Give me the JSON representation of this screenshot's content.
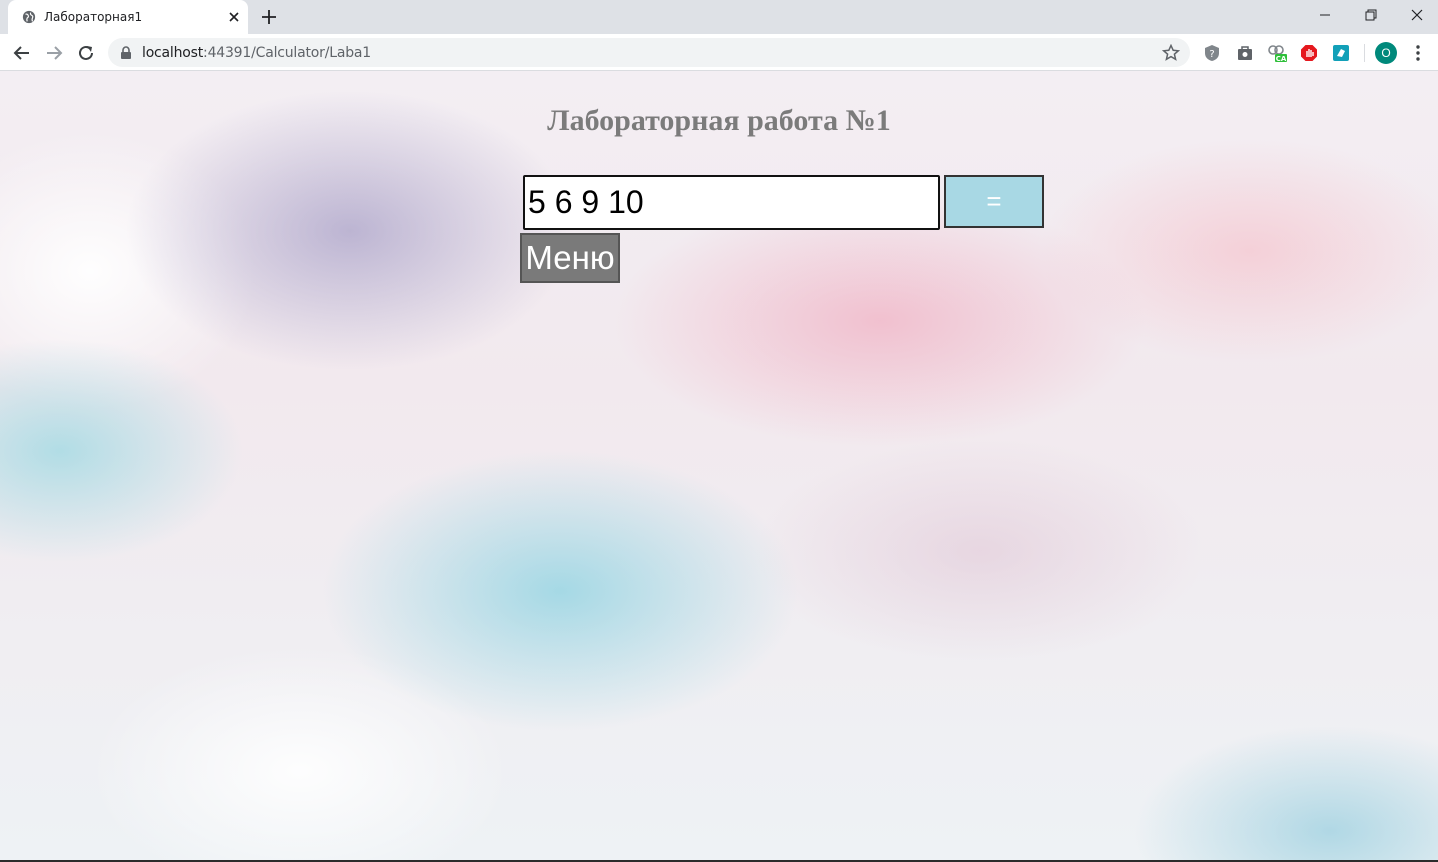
{
  "browser": {
    "tab_title": "Лабораторная1",
    "url_host": "localhost",
    "url_rest": ":44391/Calculator/Laba1",
    "profile_initial": "O",
    "extension_badge": "CA"
  },
  "page": {
    "title": "Лабораторная работа №1",
    "input_value": "5 6 9 10",
    "equals_label": "=",
    "menu_label": "Меню"
  },
  "colors": {
    "title": "#7b7b7b",
    "equals_bg": "#a8d8e4",
    "menu_bg": "#7a7a7a",
    "avatar_bg": "#00897b"
  }
}
